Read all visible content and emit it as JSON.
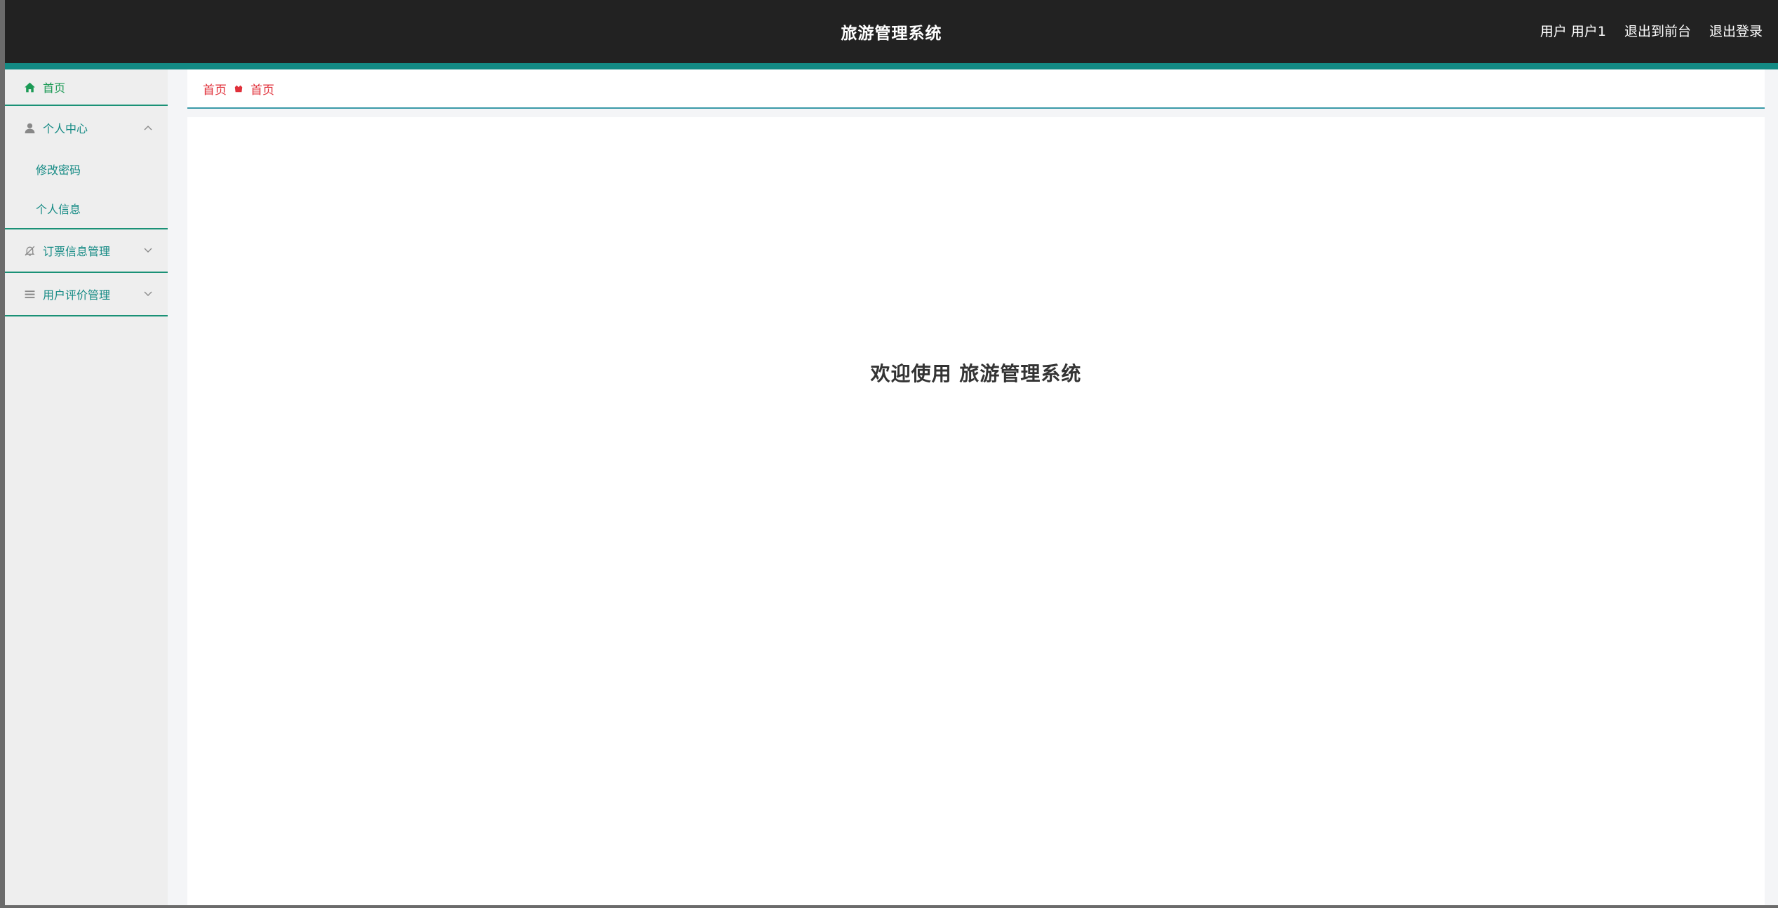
{
  "header": {
    "title": "旅游管理系统",
    "user_label": "用户 用户1",
    "front_link": "退出到前台",
    "logout_link": "退出登录"
  },
  "sidebar": {
    "items": [
      {
        "label": "首页",
        "icon": "home-icon"
      },
      {
        "label": "个人中心",
        "icon": "user-icon",
        "expanded": true,
        "children": [
          "修改密码",
          "个人信息"
        ]
      },
      {
        "label": "订票信息管理",
        "icon": "bell-off-icon",
        "expanded": false
      },
      {
        "label": "用户评价管理",
        "icon": "list-icon",
        "expanded": false
      }
    ]
  },
  "breadcrumb": {
    "root": "首页",
    "current": "首页"
  },
  "main": {
    "welcome_text": "欢迎使用 旅游管理系统"
  },
  "colors": {
    "header_bg": "#222222",
    "accent": "#138a84",
    "menu_text": "#148a84",
    "breadcrumb_text": "#e0303a"
  }
}
